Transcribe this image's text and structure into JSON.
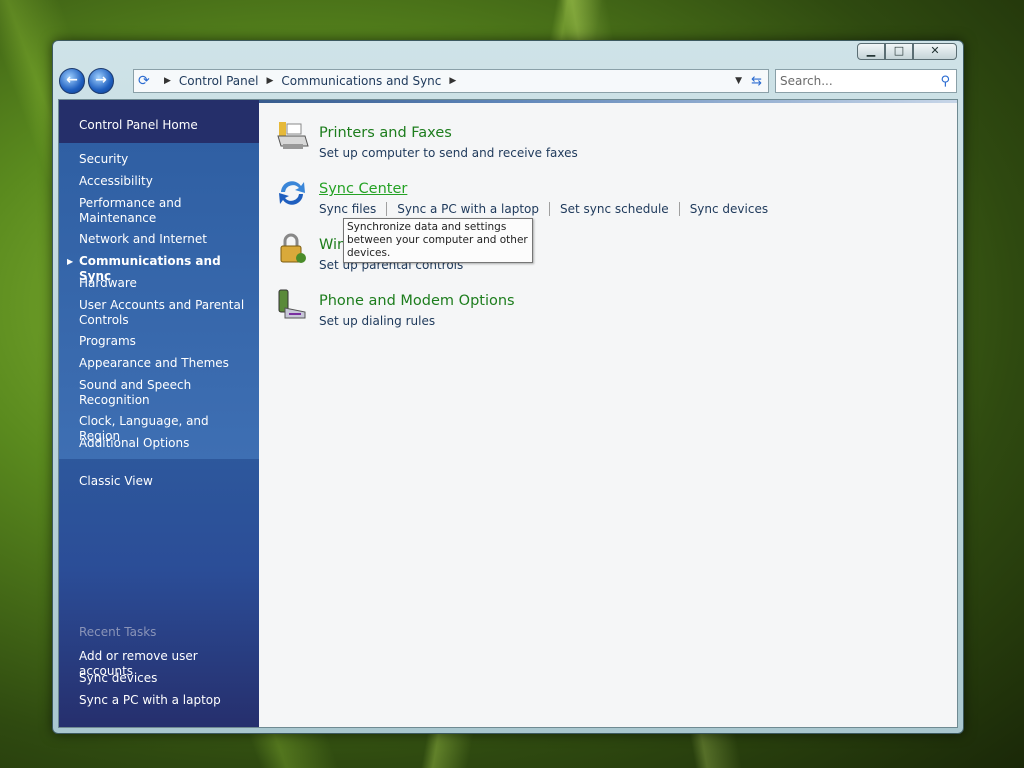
{
  "window": {
    "caption_buttons": {
      "minimize": "▁",
      "maximize": "□",
      "close": "✕"
    }
  },
  "toolbar": {
    "back_icon": "back-arrow-icon",
    "forward_icon": "forward-arrow-icon",
    "breadcrumbs": [
      "Control Panel",
      "Communications and Sync"
    ],
    "search_placeholder": "Search..."
  },
  "sidebar": {
    "home": "Control Panel Home",
    "categories": [
      "Security",
      "Accessibility",
      "Performance and Maintenance",
      "Network and Internet",
      "Communications and Sync",
      "Hardware",
      "User Accounts and Parental Controls",
      "Programs",
      "Appearance and Themes",
      "Sound and Speech Recognition",
      "Clock, Language, and Region",
      "Additional Options"
    ],
    "active_index": 4,
    "classic_view": "Classic View",
    "recent_heading": "Recent Tasks",
    "recent_tasks": [
      "Add or remove user accounts",
      "Sync devices",
      "Sync a PC with a laptop"
    ]
  },
  "main": {
    "items": [
      {
        "title": "Printers and Faxes",
        "links": [
          "Set up computer to send and receive faxes"
        ],
        "icon": "printer-icon"
      },
      {
        "title": "Sync Center",
        "links": [
          "Sync files",
          "Sync a PC with a laptop",
          "Set sync schedule",
          "Sync devices"
        ],
        "icon": "sync-icon"
      },
      {
        "title": "Wir",
        "links": [
          "Set up parental controls"
        ],
        "icon": "lock-icon"
      },
      {
        "title": "Phone and Modem Options",
        "links": [
          "Set up dialing rules"
        ],
        "icon": "phone-icon"
      }
    ],
    "tooltip": "Synchronize data and settings between your computer and other devices."
  },
  "colors": {
    "link_green": "#1d7d1d",
    "sidebar_blue": "#2f5fa3"
  }
}
